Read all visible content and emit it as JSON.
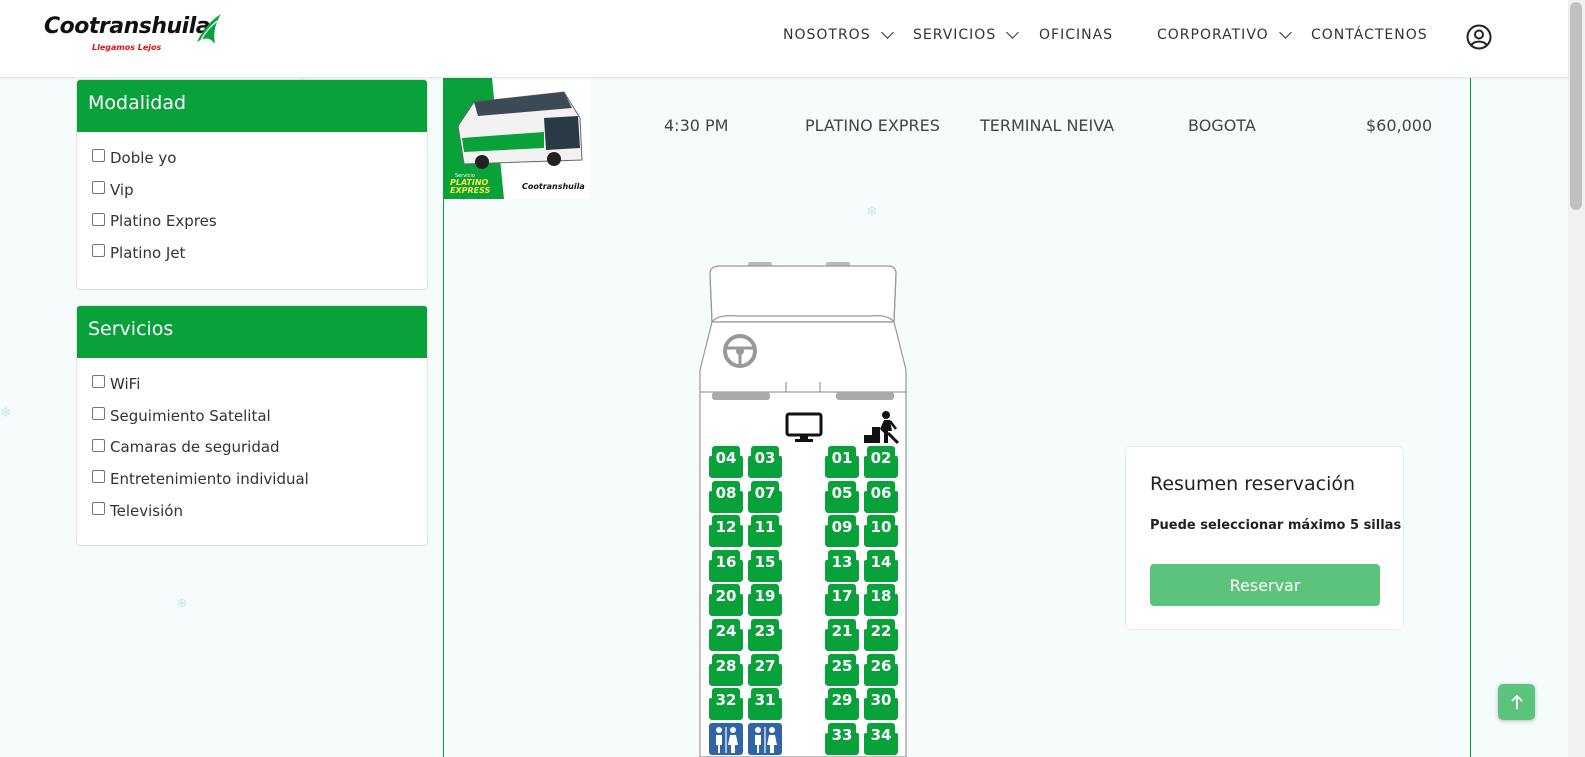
{
  "brand": {
    "name": "Cootranshuila",
    "tagline": "Llegamos Lejos",
    "green": "#08a13a",
    "light_green": "#5cc37d"
  },
  "nav": {
    "items": [
      {
        "label": "NOSOTROS",
        "has_dropdown": true
      },
      {
        "label": "SERVICIOS",
        "has_dropdown": true
      },
      {
        "label": "OFICINAS",
        "has_dropdown": false
      },
      {
        "label": "CORPORATIVO",
        "has_dropdown": true
      },
      {
        "label": "CONTÁCTENOS",
        "has_dropdown": false
      }
    ],
    "user_icon": "user-circle-icon"
  },
  "filters": {
    "modalidad": {
      "title": "Modalidad",
      "options": [
        "Doble yo",
        "Vip",
        "Platino Expres",
        "Platino Jet"
      ]
    },
    "servicios": {
      "title": "Servicios",
      "options": [
        "WiFi",
        "Seguimiento Satelital",
        "Camaras de seguridad",
        "Entretenimiento individual",
        "Televisión"
      ]
    }
  },
  "trip": {
    "time": "4:30 PM",
    "modality": "PLATINO EXPRES",
    "origin": "TERMINAL NEIVA",
    "destination": "BOGOTA",
    "price": "$60,000",
    "thumb_label": "PLATINO EXPRESS",
    "thumb_service": "Servicio",
    "thumb_brand": "Cootranshuila"
  },
  "seatmap": {
    "icons": [
      "steering-wheel-icon",
      "tv-monitor-icon",
      "stairs-person-icon",
      "restroom-icon"
    ],
    "rows": [
      [
        "04",
        "03",
        "01",
        "02"
      ],
      [
        "08",
        "07",
        "05",
        "06"
      ],
      [
        "12",
        "11",
        "09",
        "10"
      ],
      [
        "16",
        "15",
        "13",
        "14"
      ],
      [
        "20",
        "19",
        "17",
        "18"
      ],
      [
        "24",
        "23",
        "21",
        "22"
      ],
      [
        "28",
        "27",
        "25",
        "26"
      ],
      [
        "32",
        "31",
        "29",
        "30"
      ],
      [
        "WC",
        "WC",
        "33",
        "34"
      ]
    ]
  },
  "summary": {
    "title": "Resumen reservación",
    "subtitle": "Puede seleccionar máximo 5 sillas",
    "button": "Reservar"
  }
}
